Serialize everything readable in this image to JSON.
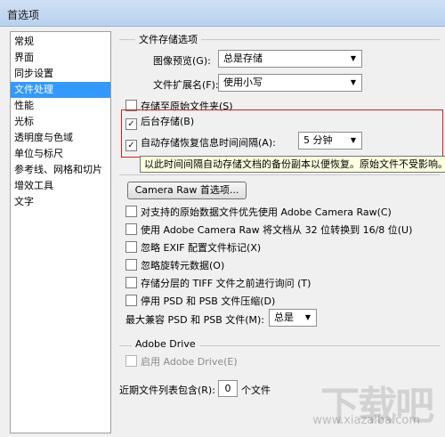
{
  "window": {
    "title": "首选项"
  },
  "sidebar": {
    "items": [
      {
        "label": "常规"
      },
      {
        "label": "界面"
      },
      {
        "label": "同步设置"
      },
      {
        "label": "文件处理"
      },
      {
        "label": "性能"
      },
      {
        "label": "光标"
      },
      {
        "label": "透明度与色域"
      },
      {
        "label": "单位与标尺"
      },
      {
        "label": "参考线、网格和切片"
      },
      {
        "label": "增效工具"
      },
      {
        "label": "文字"
      }
    ],
    "selected": "文件处理"
  },
  "file_saving": {
    "group_title": "文件存储选项",
    "image_preview_label": "图像预览(G):",
    "image_preview_value": "总是存储",
    "extension_label": "文件扩展名(F):",
    "extension_value": "使用小写",
    "save_to_original_label": "存储至原始文件夹(S)",
    "background_save_label": "后台存储(B)",
    "autosave_label": "自动存储恢复信息时间间隔(A):",
    "autosave_interval": "5 分钟",
    "tooltip": "以此时间间隔自动存储文档的备份副本以便恢复。原始文件不受影响。"
  },
  "compat": {
    "camera_raw_button": "Camera Raw 首选项...",
    "options": [
      {
        "label": "对支持的原始数据文件优先使用 Adobe Camera Raw(C)"
      },
      {
        "label": "使用 Adobe Camera Raw 将文档从 32 位转换到 16/8 位(U)"
      },
      {
        "label": "忽略 EXIF 配置文件标记(X)"
      },
      {
        "label": "忽略旋转元数据(O)"
      },
      {
        "label": "存储分层的 TIFF 文件之前进行询问 (T)"
      },
      {
        "label": "停用 PSD 和 PSB 文件压缩(D)"
      }
    ],
    "max_compat_label": "最大兼容 PSD 和 PSB 文件(M):",
    "max_compat_value": "总是"
  },
  "adobe_drive": {
    "group_title": "Adobe Drive",
    "enable_label": "启用 Adobe Drive(E)"
  },
  "recent": {
    "label": "近期文件列表包含(R):",
    "value": "0",
    "suffix": "个文件"
  },
  "watermark": {
    "big": "下载吧",
    "small": "www.xiazaiba.com"
  },
  "colors": {
    "selection": "#3399ff",
    "highlight_border": "#d02020",
    "tooltip_bg": "#ffffe1"
  }
}
